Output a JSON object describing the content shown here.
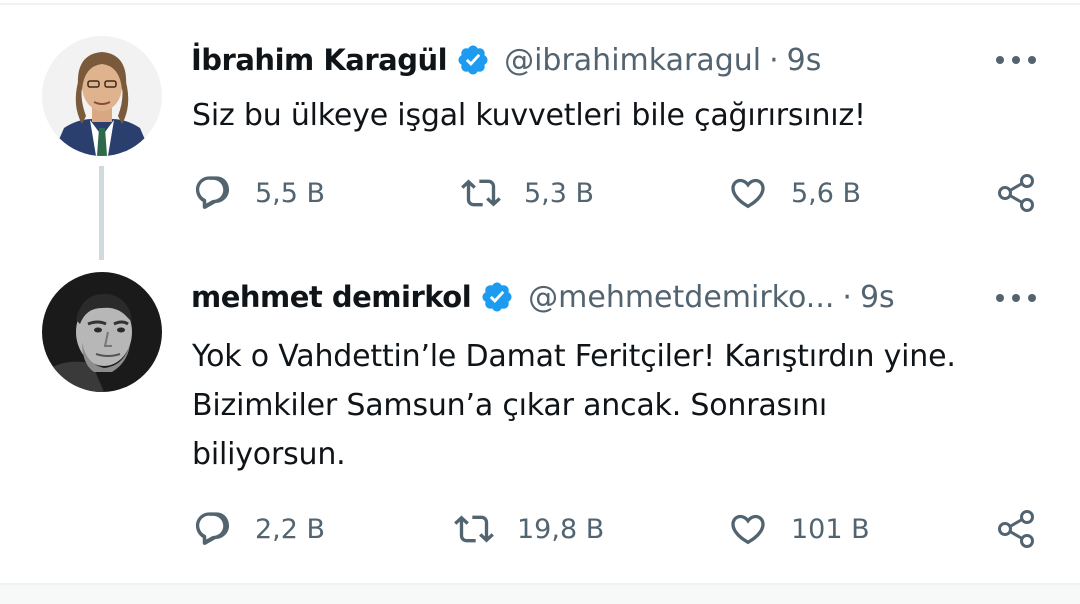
{
  "tweets": [
    {
      "name": "İbrahim Karagül",
      "handle": "@ibrahimkaragul",
      "separator": "·",
      "time": "9s",
      "text_lines": [
        "Siz bu ülkeye işgal kuvvetleri bile çağırırsınız!"
      ],
      "replies": "5,5 B",
      "retweets": "5,3 B",
      "likes": "5,6 B"
    },
    {
      "name": "mehmet demirkol",
      "handle": "@mehmetdemirko...",
      "separator": "·",
      "time": "9s",
      "text_lines": [
        "Yok o Vahdettin’le Damat Feritçiler! Karıştırdın yine.",
        "Bizimkiler Samsun’a çıkar ancak. Sonrasını",
        "biliyorsun."
      ],
      "replies": "2,2 B",
      "retweets": "19,8 B",
      "likes": "101 B"
    }
  ],
  "icons": {
    "verified": "verified-badge-icon",
    "more": "more-options-icon",
    "reply": "reply-icon",
    "retweet": "retweet-icon",
    "like": "like-icon",
    "share": "share-icon"
  },
  "colors": {
    "text": "#0f1419",
    "secondary": "#536471",
    "verified": "#1d9bf0",
    "thread_line": "#cfd9de"
  }
}
